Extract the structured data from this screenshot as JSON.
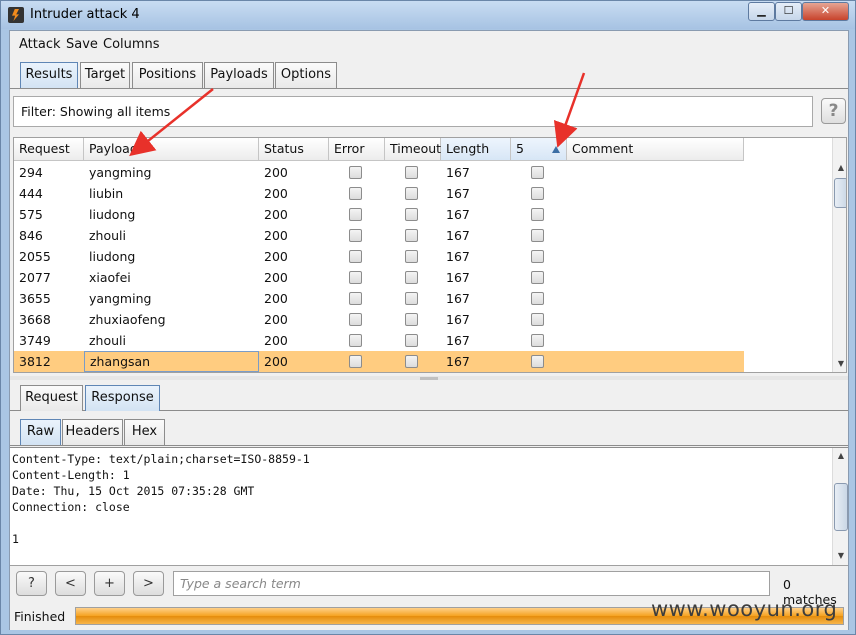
{
  "window": {
    "title": "Intruder attack 4",
    "min_label": "▁",
    "max_label": "☐",
    "close_label": "✕"
  },
  "menu": {
    "items": [
      "Attack",
      "Save",
      "Columns"
    ]
  },
  "main_tabs": [
    {
      "label": "Results",
      "active": true
    },
    {
      "label": "Target",
      "active": false
    },
    {
      "label": "Positions",
      "active": false
    },
    {
      "label": "Payloads",
      "active": false
    },
    {
      "label": "Options",
      "active": false
    }
  ],
  "filter": {
    "text": "Filter: Showing all items",
    "help_label": "?"
  },
  "table": {
    "columns": [
      "Request",
      "Payload",
      "Status",
      "Error",
      "Timeout",
      "Length",
      "5",
      "Comment"
    ],
    "sorted_column": "5",
    "rows": [
      {
        "request": "294",
        "payload": "yangming",
        "status": "200",
        "length": "167"
      },
      {
        "request": "444",
        "payload": "liubin",
        "status": "200",
        "length": "167"
      },
      {
        "request": "575",
        "payload": "liudong",
        "status": "200",
        "length": "167"
      },
      {
        "request": "846",
        "payload": "zhouli",
        "status": "200",
        "length": "167"
      },
      {
        "request": "2055",
        "payload": "liudong",
        "status": "200",
        "length": "167"
      },
      {
        "request": "2077",
        "payload": "xiaofei",
        "status": "200",
        "length": "167"
      },
      {
        "request": "3655",
        "payload": "yangming",
        "status": "200",
        "length": "167"
      },
      {
        "request": "3668",
        "payload": "zhuxiaofeng",
        "status": "200",
        "length": "167"
      },
      {
        "request": "3749",
        "payload": "zhouli",
        "status": "200",
        "length": "167"
      },
      {
        "request": "3812",
        "payload": "zhangsan",
        "status": "200",
        "length": "167",
        "selected": true
      }
    ]
  },
  "detail_tabs": [
    {
      "label": "Request",
      "active": false
    },
    {
      "label": "Response",
      "active": true
    }
  ],
  "view_tabs": [
    {
      "label": "Raw",
      "active": true
    },
    {
      "label": "Headers",
      "active": false
    },
    {
      "label": "Hex",
      "active": false
    }
  ],
  "response_raw": [
    "Content-Type: text/plain;charset=ISO-8859-1",
    "Content-Length: 1",
    "Date: Thu, 15 Oct 2015 07:35:28 GMT",
    "Connection: close",
    "",
    "1"
  ],
  "search": {
    "help_label": "?",
    "prev_label": "<",
    "add_label": "+",
    "next_label": ">",
    "placeholder": "Type a search term",
    "matches": "0 matches"
  },
  "status": {
    "text": "Finished",
    "progress": 1.0
  },
  "watermark": "www.wooyun.org",
  "colors": {
    "selected_row": "#ffcc80",
    "progress": "#f5a21f",
    "annotation_arrow": "#e8312a"
  },
  "icons": {
    "app": "burp-lightning-icon",
    "sort": "sort-ascending-icon"
  }
}
